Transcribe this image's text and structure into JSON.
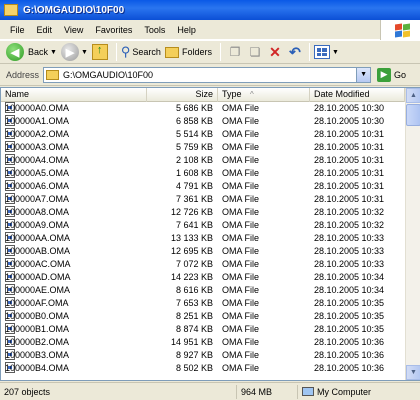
{
  "window": {
    "title": "G:\\OMGAUDIO\\10F00"
  },
  "menu": [
    "File",
    "Edit",
    "View",
    "Favorites",
    "Tools",
    "Help"
  ],
  "toolbar": {
    "back_label": "Back",
    "search_label": "Search",
    "folders_label": "Folders"
  },
  "address": {
    "label": "Address",
    "value": "G:\\OMGAUDIO\\10F00",
    "go_label": "Go"
  },
  "columns": {
    "name": "Name",
    "size": "Size",
    "type": "Type",
    "sort_indicator": "^",
    "date": "Date Modified"
  },
  "files": [
    {
      "name": "100000A0.OMA",
      "size": "5 686 KB",
      "type": "OMA File",
      "date": "28.10.2005 10:30"
    },
    {
      "name": "100000A1.OMA",
      "size": "6 858 KB",
      "type": "OMA File",
      "date": "28.10.2005 10:30"
    },
    {
      "name": "100000A2.OMA",
      "size": "5 514 KB",
      "type": "OMA File",
      "date": "28.10.2005 10:31"
    },
    {
      "name": "100000A3.OMA",
      "size": "5 759 KB",
      "type": "OMA File",
      "date": "28.10.2005 10:31"
    },
    {
      "name": "100000A4.OMA",
      "size": "2 108 KB",
      "type": "OMA File",
      "date": "28.10.2005 10:31"
    },
    {
      "name": "100000A5.OMA",
      "size": "1 608 KB",
      "type": "OMA File",
      "date": "28.10.2005 10:31"
    },
    {
      "name": "100000A6.OMA",
      "size": "4 791 KB",
      "type": "OMA File",
      "date": "28.10.2005 10:31"
    },
    {
      "name": "100000A7.OMA",
      "size": "7 361 KB",
      "type": "OMA File",
      "date": "28.10.2005 10:31"
    },
    {
      "name": "100000A8.OMA",
      "size": "12 726 KB",
      "type": "OMA File",
      "date": "28.10.2005 10:32"
    },
    {
      "name": "100000A9.OMA",
      "size": "7 641 KB",
      "type": "OMA File",
      "date": "28.10.2005 10:32"
    },
    {
      "name": "100000AA.OMA",
      "size": "13 133 KB",
      "type": "OMA File",
      "date": "28.10.2005 10:33"
    },
    {
      "name": "100000AB.OMA",
      "size": "12 695 KB",
      "type": "OMA File",
      "date": "28.10.2005 10:33"
    },
    {
      "name": "100000AC.OMA",
      "size": "7 072 KB",
      "type": "OMA File",
      "date": "28.10.2005 10:33"
    },
    {
      "name": "100000AD.OMA",
      "size": "14 223 KB",
      "type": "OMA File",
      "date": "28.10.2005 10:34"
    },
    {
      "name": "100000AE.OMA",
      "size": "8 616 KB",
      "type": "OMA File",
      "date": "28.10.2005 10:34"
    },
    {
      "name": "100000AF.OMA",
      "size": "7 653 KB",
      "type": "OMA File",
      "date": "28.10.2005 10:35"
    },
    {
      "name": "100000B0.OMA",
      "size": "8 251 KB",
      "type": "OMA File",
      "date": "28.10.2005 10:35"
    },
    {
      "name": "100000B1.OMA",
      "size": "8 874 KB",
      "type": "OMA File",
      "date": "28.10.2005 10:35"
    },
    {
      "name": "100000B2.OMA",
      "size": "14 951 KB",
      "type": "OMA File",
      "date": "28.10.2005 10:36"
    },
    {
      "name": "100000B3.OMA",
      "size": "8 927 KB",
      "type": "OMA File",
      "date": "28.10.2005 10:36"
    },
    {
      "name": "100000B4.OMA",
      "size": "8 502 KB",
      "type": "OMA File",
      "date": "28.10.2005 10:36"
    }
  ],
  "status": {
    "objects": "207 objects",
    "size": "964 MB",
    "location": "My Computer"
  }
}
